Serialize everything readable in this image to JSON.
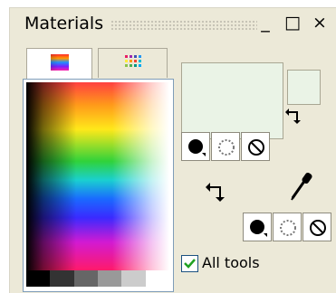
{
  "window": {
    "title": "Materials"
  },
  "title_buttons": [
    {
      "name": "minimize-button",
      "glyph": "_"
    },
    {
      "name": "maximize-button",
      "glyph": "□"
    },
    {
      "name": "close-button",
      "glyph": "×"
    }
  ],
  "tabs": [
    {
      "name": "tab-frame",
      "icon": "color-frame-icon",
      "active": true
    },
    {
      "name": "tab-swatches",
      "icon": "swatches-grid-icon",
      "active": false
    }
  ],
  "colors": {
    "foreground": "#eaf3e6",
    "background": "#eaf3e6",
    "checkbox_border": "#1c5180",
    "check_mark": "#21a121"
  },
  "foreground_buttons": [
    "color-style-icon",
    "texture-icon",
    "transparent-icon"
  ],
  "background_buttons": [
    "color-style-icon",
    "texture-icon",
    "transparent-icon"
  ],
  "swap": {
    "icon": "swap-arrows-icon"
  },
  "eyedropper": {
    "icon": "eyedropper-icon"
  },
  "all_tools": {
    "label": "All tools",
    "checked": true
  }
}
